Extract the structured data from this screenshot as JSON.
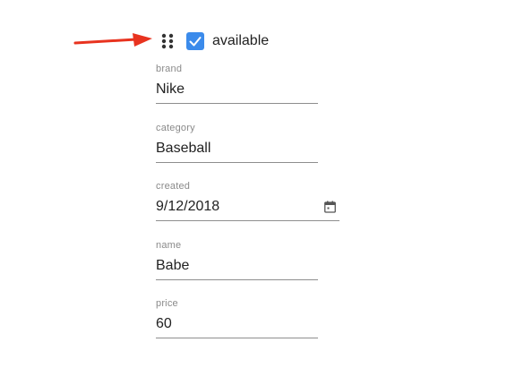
{
  "form": {
    "available": {
      "label": "available",
      "checked": true
    },
    "fields": {
      "brand": {
        "label": "brand",
        "value": "Nike"
      },
      "category": {
        "label": "category",
        "value": "Baseball"
      },
      "created": {
        "label": "created",
        "value": "9/12/2018"
      },
      "name": {
        "label": "name",
        "value": "Babe"
      },
      "price": {
        "label": "price",
        "value": "60"
      }
    }
  },
  "icons": {
    "arrow": "red-arrow-icon",
    "drag": "drag-handle-icon",
    "check": "check-icon",
    "calendar": "calendar-icon"
  },
  "colors": {
    "accent": "#3b8beb",
    "arrow": "#e8331f",
    "text": "#222222",
    "label": "#8a8a8a",
    "underline": "#8e8e8e"
  }
}
